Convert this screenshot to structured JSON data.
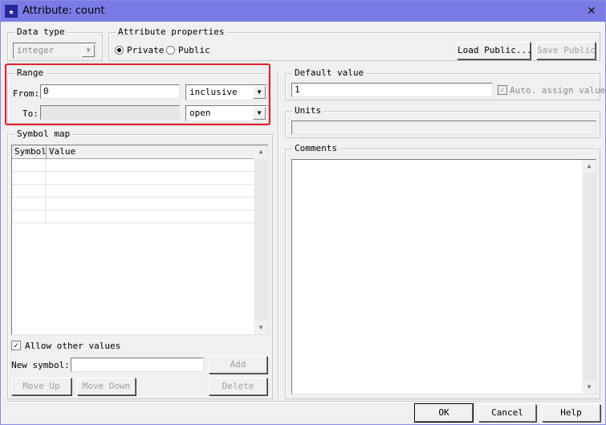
{
  "window": {
    "title": "Attribute: count",
    "app_icon": "star-icon",
    "close_glyph": "✕"
  },
  "data_type": {
    "legend": "Data type",
    "value": "integer"
  },
  "attribute_properties": {
    "legend": "Attribute properties",
    "private_label": "Private",
    "public_label": "Public",
    "selected": "Private",
    "load_public": "Load Public...",
    "save_public": "Save Public"
  },
  "range": {
    "legend": "Range",
    "from_label": "From:",
    "from_value": "0",
    "from_bound": "inclusive",
    "to_label": "To:",
    "to_value": "",
    "to_bound": "open"
  },
  "default_value": {
    "legend": "Default value",
    "value": "1",
    "auto_assign_label": "Auto. assign value",
    "auto_assign_checked": true
  },
  "units": {
    "legend": "Units",
    "value": ""
  },
  "comments": {
    "legend": "Comments",
    "value": ""
  },
  "symbol_map": {
    "legend": "Symbol map",
    "columns": [
      "Symbol",
      "Value"
    ],
    "rows": [
      [
        "",
        ""
      ],
      [
        "",
        ""
      ],
      [
        "",
        ""
      ],
      [
        "",
        ""
      ],
      [
        "",
        ""
      ]
    ],
    "allow_other_label": "Allow other values",
    "allow_other_checked": true,
    "new_symbol_label": "New symbol:",
    "new_symbol_value": "",
    "add": "Add",
    "move_up": "Move Up",
    "move_down": "Move Down",
    "delete": "Delete"
  },
  "footer": {
    "ok": "OK",
    "cancel": "Cancel",
    "help": "Help"
  }
}
